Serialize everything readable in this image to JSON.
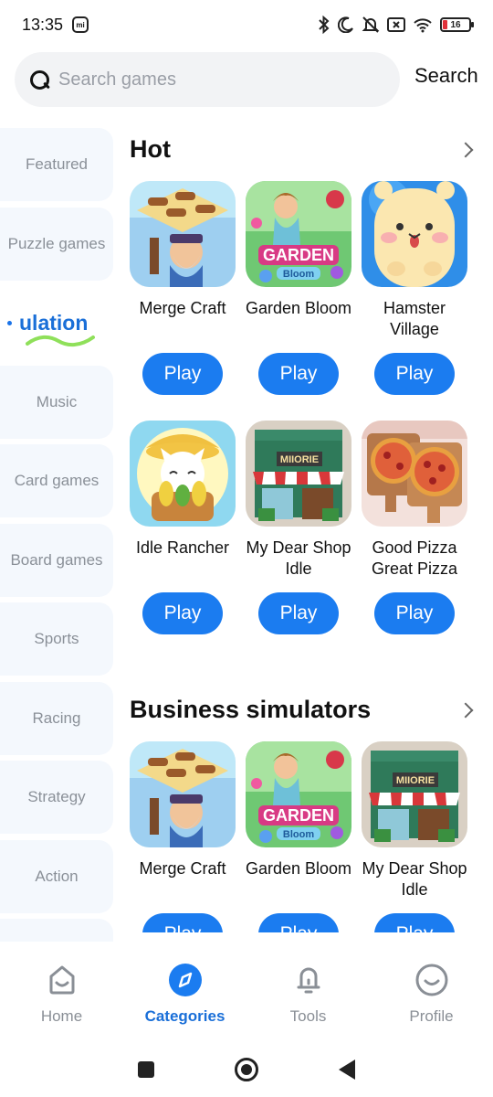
{
  "status_bar": {
    "time": "13:35",
    "mi_badge": "mi",
    "battery": "16",
    "icons": [
      "bluetooth-icon",
      "moon-icon",
      "mute-icon",
      "sim-off-icon",
      "wifi-icon",
      "battery-icon"
    ]
  },
  "search": {
    "placeholder": "Search games",
    "button_label": "Search"
  },
  "sidebar": {
    "items": [
      {
        "label": "Featured"
      },
      {
        "label": "Puzzle games"
      },
      {
        "label": "ulation",
        "active": true
      },
      {
        "label": "Music"
      },
      {
        "label": "Card games"
      },
      {
        "label": "Board games"
      },
      {
        "label": "Sports"
      },
      {
        "label": "Racing"
      },
      {
        "label": "Strategy"
      },
      {
        "label": "Action"
      }
    ]
  },
  "sections": [
    {
      "title": "Hot",
      "games": [
        {
          "name": "Merge Craft",
          "icon": "merge-craft"
        },
        {
          "name": "Garden Bloom",
          "icon": "garden-bloom"
        },
        {
          "name": "Hamster Village",
          "icon": "hamster-village"
        },
        {
          "name": "Idle Rancher",
          "icon": "idle-rancher"
        },
        {
          "name": "My Dear Shop Idle",
          "icon": "my-dear-shop"
        },
        {
          "name": "Good Pizza Great Pizza",
          "icon": "good-pizza"
        }
      ]
    },
    {
      "title": "Business simulators",
      "games": [
        {
          "name": "Merge Craft",
          "icon": "merge-craft"
        },
        {
          "name": "Garden Bloom",
          "icon": "garden-bloom"
        },
        {
          "name": "My Dear Shop Idle",
          "icon": "my-dear-shop"
        }
      ]
    }
  ],
  "icon_text": {
    "garden": "GARDEN",
    "bloom": "Bloom",
    "shop_sign": "MIIORIE"
  },
  "play_label": "Play",
  "bottom_nav": [
    {
      "label": "Home",
      "icon": "home-icon"
    },
    {
      "label": "Categories",
      "icon": "compass-icon",
      "active": true
    },
    {
      "label": "Tools",
      "icon": "bell-icon"
    },
    {
      "label": "Profile",
      "icon": "smile-icon"
    }
  ],
  "colors": {
    "accent": "#1b7cf0",
    "active_text": "#1a6fd8",
    "squiggle": "#8fe05a"
  }
}
